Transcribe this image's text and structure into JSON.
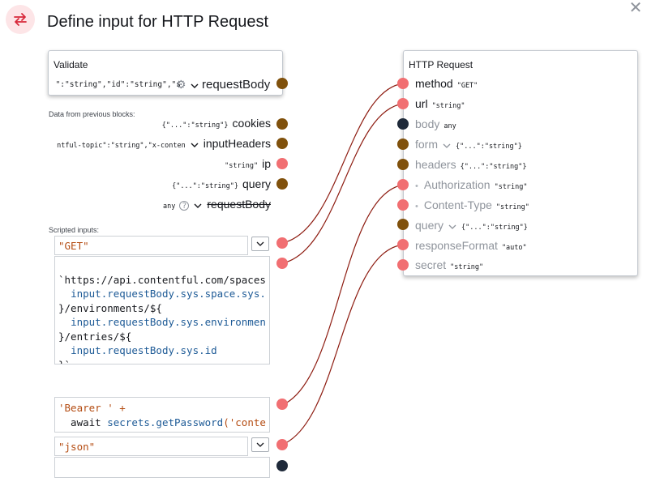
{
  "header": {
    "title": "Define input for HTTP Request",
    "icon": "swap-arrows-icon",
    "close_icon": "close-icon"
  },
  "validate_block": {
    "title": "Validate",
    "clipped_value": "\":\"string\",\"id\":\"string\",\"s",
    "output_name": "requestBody"
  },
  "previous_blocks": {
    "label": "Data from previous blocks:",
    "rows": [
      {
        "type": "{\"...\":\"string\"}",
        "name": "cookies"
      },
      {
        "type": "ntful-topic\":\"string\",\"x-conten",
        "name": "inputHeaders"
      },
      {
        "type": "\"string\"",
        "name": "ip"
      },
      {
        "type": "{\"...\":\"string\"}",
        "name": "query"
      },
      {
        "type": "any",
        "name": "requestBody"
      }
    ]
  },
  "scripted": {
    "label": "Scripted inputs:",
    "method_value": "\"GET\"",
    "url_lines": [
      {
        "a": "`https://api.contentful.com/spaces",
        "b": ""
      },
      {
        "a": "  ",
        "b": "input.requestBody.sys.space.sys."
      },
      {
        "a": "}/environments/${",
        "b": ""
      },
      {
        "a": "  ",
        "b": "input.requestBody.sys.environmen"
      },
      {
        "a": "}/entries/${",
        "b": ""
      },
      {
        "a": "  ",
        "b": "input.requestBody.sys.id"
      },
      {
        "a": "}`",
        "b": ""
      }
    ],
    "auth_line1": "'Bearer ' +",
    "auth_line2_kw": "  await ",
    "auth_line2_id": "secrets.getPassword",
    "auth_line2_str": "('conte",
    "format_value": "\"json\""
  },
  "http_block": {
    "title": "HTTP Request",
    "rows": [
      {
        "name": "method",
        "type": "\"GET\""
      },
      {
        "name": "url",
        "type": "\"string\""
      },
      {
        "name": "body",
        "type": "any"
      },
      {
        "name": "form",
        "type": "{\"...\":\"string\"}"
      },
      {
        "name": "headers",
        "type": "{\"...\":\"string\"}"
      },
      {
        "name": "Authorization",
        "type": "\"string\""
      },
      {
        "name": "Content-Type",
        "type": "\"string\""
      },
      {
        "name": "query",
        "type": "{\"...\":\"string\"}"
      },
      {
        "name": "responseFormat",
        "type": "\"auto\""
      },
      {
        "name": "secret",
        "type": "\"string\""
      }
    ]
  },
  "colors": {
    "port_red": "#f16f72",
    "port_brown": "#80510c",
    "port_dark": "#1f2a3a",
    "wire": "#8e1d12",
    "accent": "#d8283a"
  }
}
